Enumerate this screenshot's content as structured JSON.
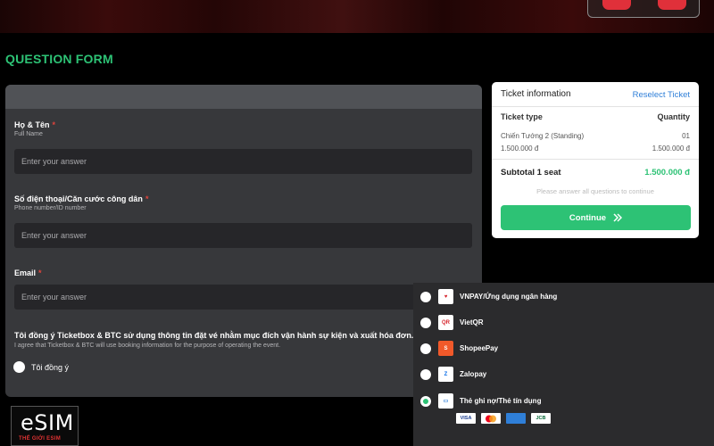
{
  "page": {
    "title": "QUESTION FORM"
  },
  "form": {
    "fields": [
      {
        "label": "Họ & Tên",
        "required": "*",
        "sublabel": "Full Name",
        "placeholder": "Enter your answer"
      },
      {
        "label": "Số điện thoại/Căn cước công dân",
        "required": "*",
        "sublabel": "Phone number/ID number",
        "placeholder": "Enter your answer"
      },
      {
        "label": "Email",
        "required": "*",
        "sublabel": "",
        "placeholder": "Enter your answer"
      }
    ],
    "consent": {
      "title": "Tôi đồng ý Ticketbox & BTC sử dụng thông tin đặt vé nhằm mục đích vận hành sự kiện và xuất hóa đơn.",
      "subtitle": "I agree that Ticketbox & BTC will use booking information for the purpose of operating the event.",
      "agree_label": "Tôi đồng ý"
    }
  },
  "ticket": {
    "header": "Ticket information",
    "reselect": "Reselect Ticket",
    "col_type": "Ticket type",
    "col_qty": "Quantity",
    "item_name": "Chiến Tướng 2 (Standing)",
    "item_qty": "01",
    "item_price": "1.500.000 đ",
    "item_total": "1.500.000 đ",
    "subtotal_label": "Subtotal 1 seat",
    "subtotal_amount": "1.500.000 đ",
    "note": "Please answer all questions to continue",
    "continue_label": "Continue"
  },
  "payment": {
    "methods": [
      {
        "label": "VNPAY/Ứng dụng ngân hàng",
        "icon": "vnpay-icon",
        "checked": false
      },
      {
        "label": "VietQR",
        "icon": "vietqr-icon",
        "checked": false
      },
      {
        "label": "ShopeePay",
        "icon": "shopeepay-icon",
        "checked": false
      },
      {
        "label": "Zalopay",
        "icon": "zalopay-icon",
        "checked": false
      },
      {
        "label": "Thẻ ghi nợ/Thẻ tín dụng",
        "icon": "credit-card-icon",
        "checked": true
      }
    ],
    "cards": [
      "VISA",
      "MC",
      "AMEX",
      "JCB"
    ]
  },
  "watermark": {
    "main": "eSIM",
    "sub": "THẾ GIỚI ESIM"
  },
  "colors": {
    "accent": "#2dc275",
    "link": "#2f7fd8",
    "required": "#e2443c",
    "panel": "#37383b"
  }
}
